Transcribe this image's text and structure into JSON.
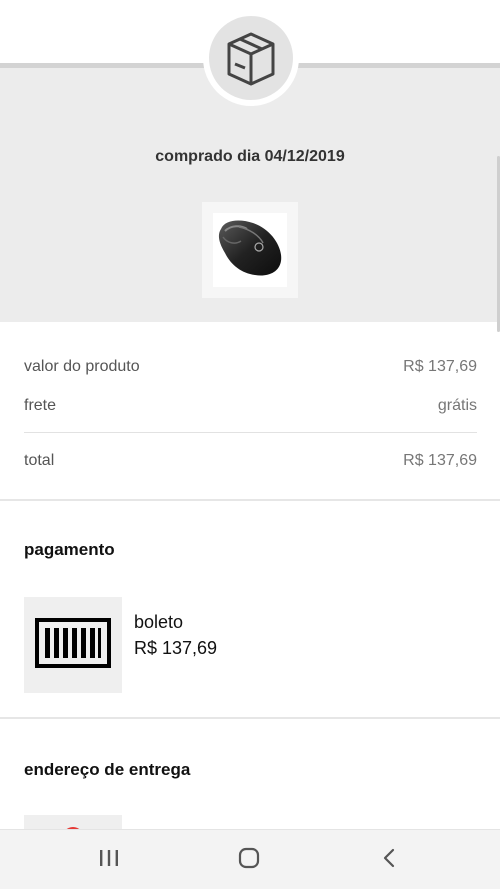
{
  "header": {
    "purchase_date": "comprado dia 04/12/2019",
    "status_icon": "package-box-icon",
    "product_image": "computer-mouse-image"
  },
  "summary": {
    "product_value_label": "valor do produto",
    "product_value": "R$ 137,69",
    "shipping_label": "frete",
    "shipping_value": "grátis",
    "total_label": "total",
    "total_value": "R$ 137,69"
  },
  "payment": {
    "title": "pagamento",
    "method_icon": "barcode-icon",
    "method": "boleto",
    "amount": "R$ 137,69"
  },
  "delivery": {
    "title": "endereço de entrega",
    "icon": "location-pin-icon"
  },
  "navbar": {
    "recent_icon": "recent-apps-icon",
    "home_icon": "home-icon",
    "back_icon": "back-icon"
  },
  "colors": {
    "header_bg": "#ececec",
    "accent_red": "#e53935"
  }
}
